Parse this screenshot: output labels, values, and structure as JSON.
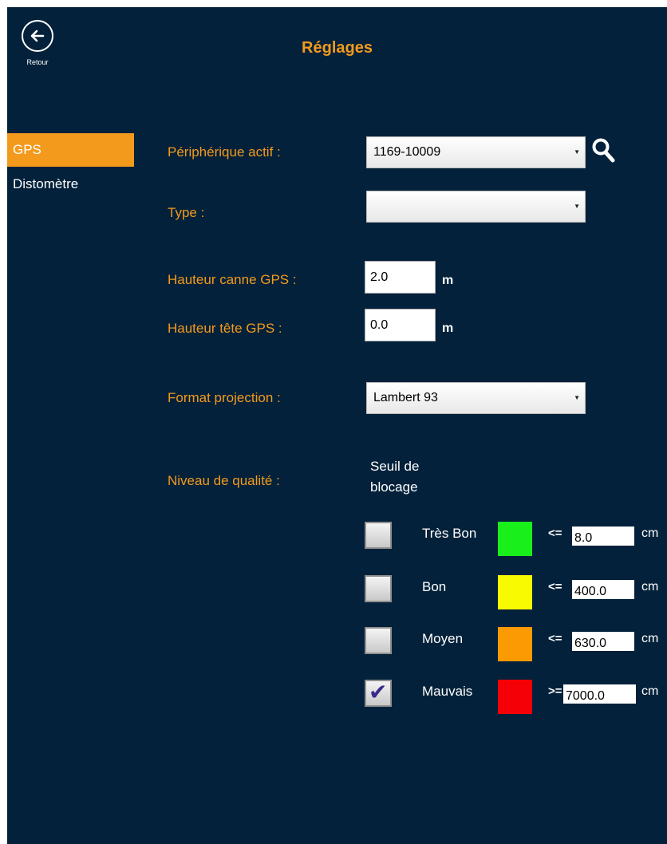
{
  "header": {
    "back_label": "Retour",
    "title": "Réglages"
  },
  "sidebar": {
    "items": [
      {
        "label": "GPS",
        "active": true
      },
      {
        "label": "Distomètre",
        "active": false
      }
    ]
  },
  "form": {
    "active_device_label": "Périphérique actif :",
    "active_device_value": "1169-10009",
    "type_label": "Type :",
    "type_value": "",
    "pole_height_label": "Hauteur canne GPS :",
    "pole_height_value": "2.0",
    "pole_height_unit": "m",
    "head_height_label": "Hauteur tête GPS :",
    "head_height_value": "0.0",
    "head_height_unit": "m",
    "projection_label": "Format projection :",
    "projection_value": "Lambert 93",
    "quality_label": "Niveau de qualité :",
    "threshold_title_line1": "Seuil de",
    "threshold_title_line2": "blocage"
  },
  "quality_levels": [
    {
      "label": "Très Bon",
      "color": "#19ef1b",
      "operator": "<=",
      "value": "8.0",
      "unit": "cm",
      "checked": false
    },
    {
      "label": "Bon",
      "color": "#f7fa00",
      "operator": "<=",
      "value": "400.0",
      "unit": "cm",
      "checked": false
    },
    {
      "label": "Moyen",
      "color": "#fb9a02",
      "operator": "<=",
      "value": "630.0",
      "unit": "cm",
      "checked": false
    },
    {
      "label": "Mauvais",
      "color": "#f40006",
      "operator": ">=",
      "value": "7000.0",
      "unit": "cm",
      "checked": true
    }
  ],
  "icons": {
    "back": "arrow-left-circle-icon",
    "search": "search-icon",
    "dropdown": "chevron-down-icon",
    "check": "checkmark-icon"
  }
}
